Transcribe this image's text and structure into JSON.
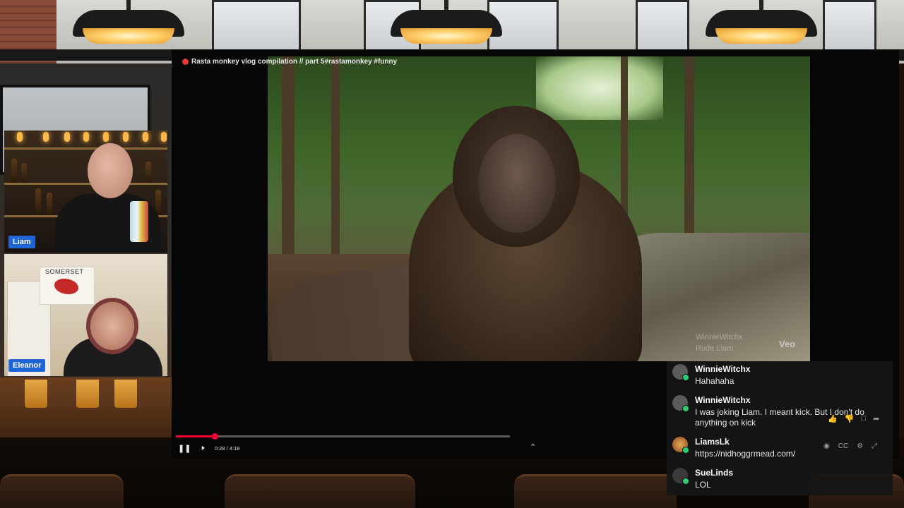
{
  "video": {
    "title": "Rasta monkey vlog compilation // part 5#rastamonkey #funny",
    "time_display": "0:28 / 4:18",
    "progress": 0.116,
    "watermark_veo": "Veo",
    "overlay_user": "WinnieWitchx",
    "overlay_text": "Rude Liam",
    "accent_color": "#ff0033"
  },
  "participants": [
    {
      "name": "Liam"
    },
    {
      "name": "Eleanor"
    }
  ],
  "eleanor_scene": {
    "flag_text": "SOMERSET"
  },
  "chat": {
    "messages": [
      {
        "user": "WinnieWitchx",
        "text": "Hahahaha"
      },
      {
        "user": "WinnieWitchx",
        "text": "I was joking Liam. I meant kick. But I don't do anything on kick"
      },
      {
        "user": "LiamsLk",
        "text": "https://nidhoggrmead.com/"
      },
      {
        "user": "SueLinds",
        "text": "LOL"
      }
    ]
  },
  "icons": {
    "pause": "pause-icon",
    "volume": "volume-icon",
    "chevron": "chevron-up-icon",
    "like": "thumbs-up-icon",
    "dislike": "thumbs-down-icon",
    "reply": "comment-icon",
    "share": "share-icon"
  }
}
